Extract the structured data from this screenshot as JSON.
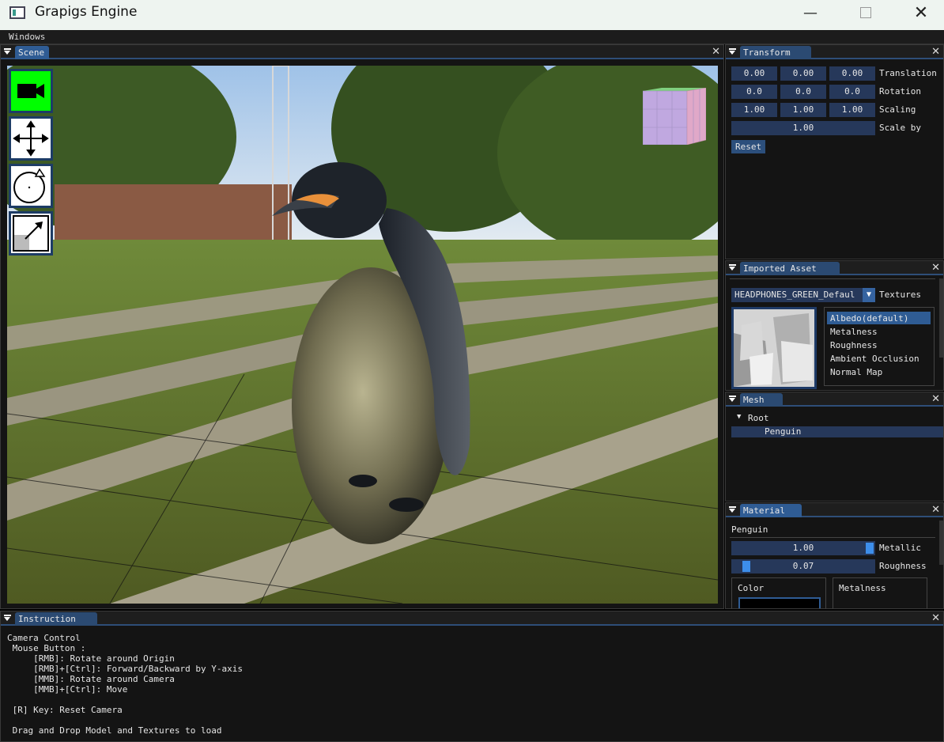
{
  "window": {
    "title": "Grapigs Engine"
  },
  "menu": {
    "windows": "Windows"
  },
  "scene": {
    "tab": "Scene"
  },
  "transform": {
    "tab": "Transform",
    "translation": [
      "0.00",
      "0.00",
      "0.00"
    ],
    "rotation": [
      "0.0",
      "0.0",
      "0.0"
    ],
    "scaling": [
      "1.00",
      "1.00",
      "1.00"
    ],
    "scale_by": "1.00",
    "labels": {
      "translation": "Translation",
      "rotation": "Rotation",
      "scaling": "Scaling",
      "scale_by": "Scale by"
    },
    "reset": "Reset"
  },
  "imported_asset": {
    "tab": "Imported Asset",
    "selected": "HEADPHONES_GREEN_Defaul",
    "textures_label": "Textures",
    "texture_list": [
      "Albedo(default)",
      "Metalness",
      "Roughness",
      "Ambient Occlusion",
      "Normal Map"
    ]
  },
  "mesh": {
    "tab": "Mesh",
    "root": "Root",
    "child": "Penguin"
  },
  "material": {
    "tab": "Material",
    "name": "Penguin",
    "metallic": {
      "value": "1.00",
      "label": "Metallic",
      "fraction": 1.0
    },
    "roughness": {
      "value": "0.07",
      "label": "Roughness",
      "fraction": 0.07
    },
    "color_label": "Color",
    "metalness_label": "Metalness"
  },
  "instruction": {
    "tab": "Instruction",
    "lines": [
      "Camera Control",
      " Mouse Button :",
      "     [RMB]: Rotate around Origin",
      "     [RMB]+[Ctrl]: Forward/Backward by Y-axis",
      "     [MMB]: Rotate around Camera",
      "     [MMB]+[Ctrl]: Move",
      "",
      " [R] Key: Reset Camera",
      "",
      " Drag and Drop Model and Textures to load"
    ]
  },
  "colors": {
    "accent": "#2f5c94",
    "camera_active": "#00ff00",
    "field": "#26385a"
  }
}
